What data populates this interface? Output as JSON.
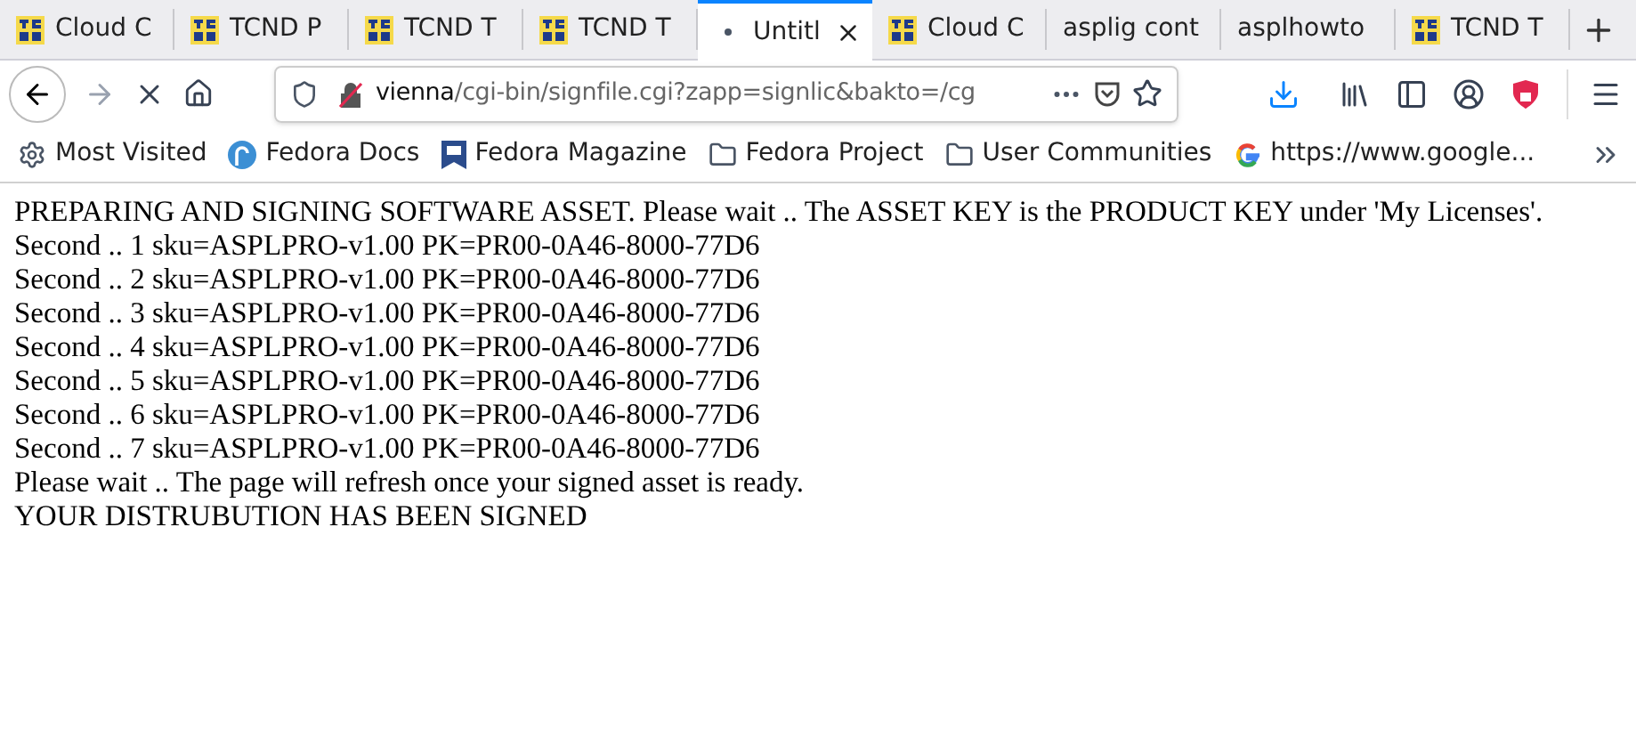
{
  "tabs": [
    {
      "title": "Cloud C",
      "kind": "logo",
      "selected": false
    },
    {
      "title": "TCND P",
      "kind": "logo",
      "selected": false
    },
    {
      "title": "TCND T",
      "kind": "logo",
      "selected": false
    },
    {
      "title": "TCND T",
      "kind": "logo",
      "selected": false
    },
    {
      "title": "Untitl",
      "kind": "loading",
      "selected": true
    },
    {
      "title": "Cloud C",
      "kind": "logo",
      "selected": false
    },
    {
      "title": "asplig cont",
      "kind": "none",
      "selected": false
    },
    {
      "title": "asplhowto",
      "kind": "none",
      "selected": false
    },
    {
      "title": "TCND T",
      "kind": "logo",
      "selected": false
    }
  ],
  "toolbar": {
    "forward_disabled": true,
    "url_host": "vienna",
    "url_path": "/cgi-bin/signfile.cgi?zapp=signlic&bakto=/cg"
  },
  "bookmarks": [
    {
      "label": "Most Visited",
      "kind": "gear"
    },
    {
      "label": "Fedora Docs",
      "kind": "fedora"
    },
    {
      "label": "Fedora Magazine",
      "kind": "fm"
    },
    {
      "label": "Fedora Project",
      "kind": "folder"
    },
    {
      "label": "User Communities",
      "kind": "folder"
    },
    {
      "label": "https://www.google...",
      "kind": "google"
    }
  ],
  "content": {
    "lines": [
      "PREPARING AND SIGNING SOFTWARE ASSET. Please wait .. The ASSET KEY is the PRODUCT KEY under 'My Licenses'.",
      "Second .. 1 sku=ASPLPRO-v1.00 PK=PR00-0A46-8000-77D6",
      "Second .. 2 sku=ASPLPRO-v1.00 PK=PR00-0A46-8000-77D6",
      "Second .. 3 sku=ASPLPRO-v1.00 PK=PR00-0A46-8000-77D6",
      "Second .. 4 sku=ASPLPRO-v1.00 PK=PR00-0A46-8000-77D6",
      "Second .. 5 sku=ASPLPRO-v1.00 PK=PR00-0A46-8000-77D6",
      "Second .. 6 sku=ASPLPRO-v1.00 PK=PR00-0A46-8000-77D6",
      "Second .. 7 sku=ASPLPRO-v1.00 PK=PR00-0A46-8000-77D6",
      "Please wait .. The page will refresh once your signed asset is ready.",
      "YOUR DISTRUBUTION HAS BEEN SIGNED"
    ]
  }
}
